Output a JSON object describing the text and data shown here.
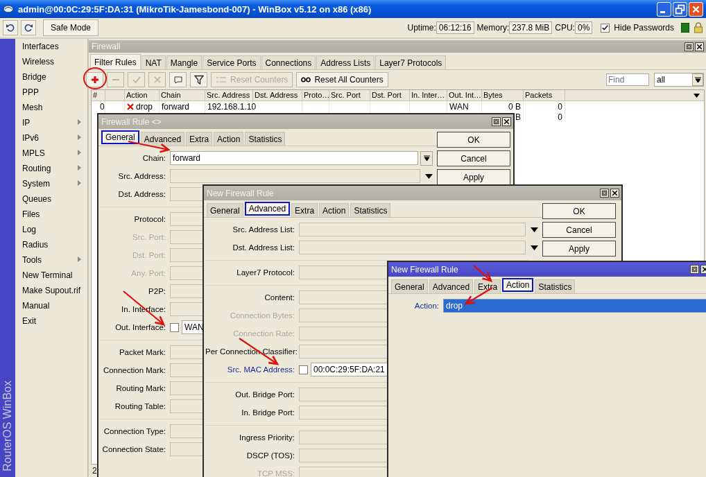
{
  "window": {
    "title": "admin@00:0C:29:5F:DA:31 (MikroTik-Jamesbond-007) - WinBox v5.12 on x86 (x86)"
  },
  "toolbar": {
    "safe_mode": "Safe Mode",
    "uptime_label": "Uptime:",
    "uptime": "06:12:16",
    "memory_label": "Memory:",
    "memory": "237.8 MiB",
    "cpu_label": "CPU:",
    "cpu": "0%",
    "hide_passwords": {
      "label": "Hide Passwords",
      "checked": true
    }
  },
  "sidebar": {
    "brand": "RouterOS WinBox",
    "items": [
      {
        "label": "Interfaces",
        "submenu": false
      },
      {
        "label": "Wireless",
        "submenu": false
      },
      {
        "label": "Bridge",
        "submenu": false
      },
      {
        "label": "PPP",
        "submenu": false
      },
      {
        "label": "Mesh",
        "submenu": false
      },
      {
        "label": "IP",
        "submenu": true
      },
      {
        "label": "IPv6",
        "submenu": true
      },
      {
        "label": "MPLS",
        "submenu": true
      },
      {
        "label": "Routing",
        "submenu": true
      },
      {
        "label": "System",
        "submenu": true
      },
      {
        "label": "Queues",
        "submenu": false
      },
      {
        "label": "Files",
        "submenu": false
      },
      {
        "label": "Log",
        "submenu": false
      },
      {
        "label": "Radius",
        "submenu": false
      },
      {
        "label": "Tools",
        "submenu": true
      },
      {
        "label": "New Terminal",
        "submenu": false
      },
      {
        "label": "Make Supout.rif",
        "submenu": false
      },
      {
        "label": "Manual",
        "submenu": false
      },
      {
        "label": "Exit",
        "submenu": false
      }
    ]
  },
  "firewall": {
    "title": "Firewall",
    "tabs": [
      {
        "label": "Filter Rules",
        "selected": true
      },
      {
        "label": "NAT",
        "selected": false
      },
      {
        "label": "Mangle",
        "selected": false
      },
      {
        "label": "Service Ports",
        "selected": false
      },
      {
        "label": "Connections",
        "selected": false
      },
      {
        "label": "Address Lists",
        "selected": false
      },
      {
        "label": "Layer7 Protocols",
        "selected": false
      }
    ],
    "tools": [
      {
        "kind": "add",
        "disabled": false
      },
      {
        "kind": "remove",
        "disabled": true
      },
      {
        "kind": "enable",
        "disabled": true
      },
      {
        "kind": "disable",
        "disabled": true
      },
      {
        "kind": "comment",
        "disabled": false
      },
      {
        "kind": "filter",
        "disabled": false
      }
    ],
    "reset_counters": {
      "label": "Reset Counters",
      "disabled": true
    },
    "reset_all_counters": {
      "label": "Reset All Counters",
      "disabled": false
    },
    "find": {
      "placeholder": "Find"
    },
    "filter_value": "all",
    "columns": [
      {
        "label": "#"
      },
      {},
      {
        "label": "Action"
      },
      {
        "label": "Chain"
      },
      {
        "label": "Src. Address"
      },
      {
        "label": "Dst. Address"
      },
      {
        "label": "Proto…"
      },
      {
        "label": "Src. Port"
      },
      {
        "label": "Dst. Port"
      },
      {
        "label": "In. Inter…"
      },
      {
        "label": "Out. Int…"
      },
      {
        "label": "Bytes"
      },
      {
        "label": "Packets"
      }
    ],
    "rows": [
      {
        "number": "0",
        "action": "drop",
        "chain": "forward",
        "src_address": "192.168.1.10",
        "out_interface": "WAN",
        "bytes": "0 B",
        "packets": "0"
      },
      {
        "bytes": "B",
        "packets": "0"
      }
    ],
    "status": "2"
  },
  "dialogs": [
    {
      "title": "Firewall Rule <>",
      "active": false,
      "tabs": [
        {
          "label": "General",
          "selected": true
        },
        {
          "label": "Advanced",
          "selected": false
        },
        {
          "label": "Extra",
          "selected": false
        },
        {
          "label": "Action",
          "selected": false
        },
        {
          "label": "Statistics",
          "selected": false
        }
      ],
      "fields": [
        {
          "kind": "combo",
          "label": "Chain:",
          "value": "forward",
          "disabled": false,
          "highlighted": false
        },
        {
          "kind": "dropdown",
          "label": "Src. Address:",
          "disabled": false,
          "highlighted": false
        },
        {
          "kind": "text",
          "label": "Dst. Address:",
          "disabled": false,
          "highlighted": false
        },
        {
          "kind": "separator"
        },
        {
          "kind": "text",
          "label": "Protocol:",
          "disabled": false,
          "highlighted": false
        },
        {
          "kind": "text",
          "label": "Src. Port:",
          "disabled": true,
          "highlighted": false
        },
        {
          "kind": "text",
          "label": "Dst. Port:",
          "disabled": true,
          "highlighted": false
        },
        {
          "kind": "text",
          "label": "Any. Port:",
          "disabled": true,
          "highlighted": false
        },
        {
          "kind": "text",
          "label": "P2P:",
          "disabled": false,
          "highlighted": false
        },
        {
          "kind": "text",
          "label": "In. Interface:",
          "disabled": false,
          "highlighted": false
        },
        {
          "kind": "check_text",
          "label": "Out. Interface:",
          "checked": false,
          "value": "WAN",
          "disabled": false,
          "highlighted": false
        },
        {
          "kind": "separator"
        },
        {
          "kind": "text",
          "label": "Packet Mark:",
          "disabled": false,
          "highlighted": false
        },
        {
          "kind": "text",
          "label": "Connection Mark:",
          "disabled": false,
          "highlighted": false
        },
        {
          "kind": "text",
          "label": "Routing Mark:",
          "disabled": false,
          "highlighted": false
        },
        {
          "kind": "text",
          "label": "Routing Table:",
          "disabled": false,
          "highlighted": false
        },
        {
          "kind": "separator"
        },
        {
          "kind": "text",
          "label": "Connection Type:",
          "disabled": false,
          "highlighted": false
        },
        {
          "kind": "text",
          "label": "Connection State:",
          "disabled": false,
          "highlighted": false
        }
      ],
      "buttons": [
        "OK",
        "Cancel",
        "Apply"
      ]
    },
    {
      "title": "New Firewall Rule",
      "active": false,
      "tabs": [
        {
          "label": "General",
          "selected": false
        },
        {
          "label": "Advanced",
          "selected": true
        },
        {
          "label": "Extra",
          "selected": false
        },
        {
          "label": "Action",
          "selected": false
        },
        {
          "label": "Statistics",
          "selected": false
        }
      ],
      "fields": [
        {
          "kind": "dropdown",
          "label": "Src. Address List:",
          "disabled": false,
          "highlighted": false
        },
        {
          "kind": "dropdown",
          "label": "Dst. Address List:",
          "disabled": false,
          "highlighted": false
        },
        {
          "kind": "separator"
        },
        {
          "kind": "text",
          "label": "Layer7 Protocol:",
          "disabled": false,
          "highlighted": false
        },
        {
          "kind": "separator"
        },
        {
          "kind": "text",
          "label": "Content:",
          "disabled": false,
          "highlighted": false
        },
        {
          "kind": "text",
          "label": "Connection Bytes:",
          "disabled": true,
          "highlighted": false
        },
        {
          "kind": "text",
          "label": "Connection Rate:",
          "disabled": true,
          "highlighted": false
        },
        {
          "kind": "text",
          "label": "Per Connection Classifier:",
          "disabled": false,
          "highlighted": false
        },
        {
          "kind": "check_text",
          "label": "Src. MAC Address:",
          "checked": false,
          "value": "00:0C:29:5F:DA:21",
          "disabled": false,
          "highlighted": true
        },
        {
          "kind": "separator"
        },
        {
          "kind": "text",
          "label": "Out. Bridge Port:",
          "disabled": false,
          "highlighted": false
        },
        {
          "kind": "text",
          "label": "In. Bridge Port:",
          "disabled": false,
          "highlighted": false
        },
        {
          "kind": "separator"
        },
        {
          "kind": "text",
          "label": "Ingress Priority:",
          "disabled": false,
          "highlighted": false
        },
        {
          "kind": "text",
          "label": "DSCP (TOS):",
          "disabled": false,
          "highlighted": false
        },
        {
          "kind": "text",
          "label": "TCP MSS:",
          "disabled": true,
          "highlighted": false
        }
      ],
      "buttons": [
        "OK",
        "Cancel",
        "Apply"
      ]
    },
    {
      "title": "New Firewall Rule",
      "active": true,
      "tabs": [
        {
          "label": "General",
          "selected": false
        },
        {
          "label": "Advanced",
          "selected": false
        },
        {
          "label": "Extra",
          "selected": false
        },
        {
          "label": "Action",
          "selected": true
        },
        {
          "label": "Statistics",
          "selected": false
        }
      ],
      "fields": [
        {
          "kind": "select",
          "label": "Action:",
          "value": "drop",
          "disabled": false,
          "highlighted": true
        }
      ]
    }
  ]
}
